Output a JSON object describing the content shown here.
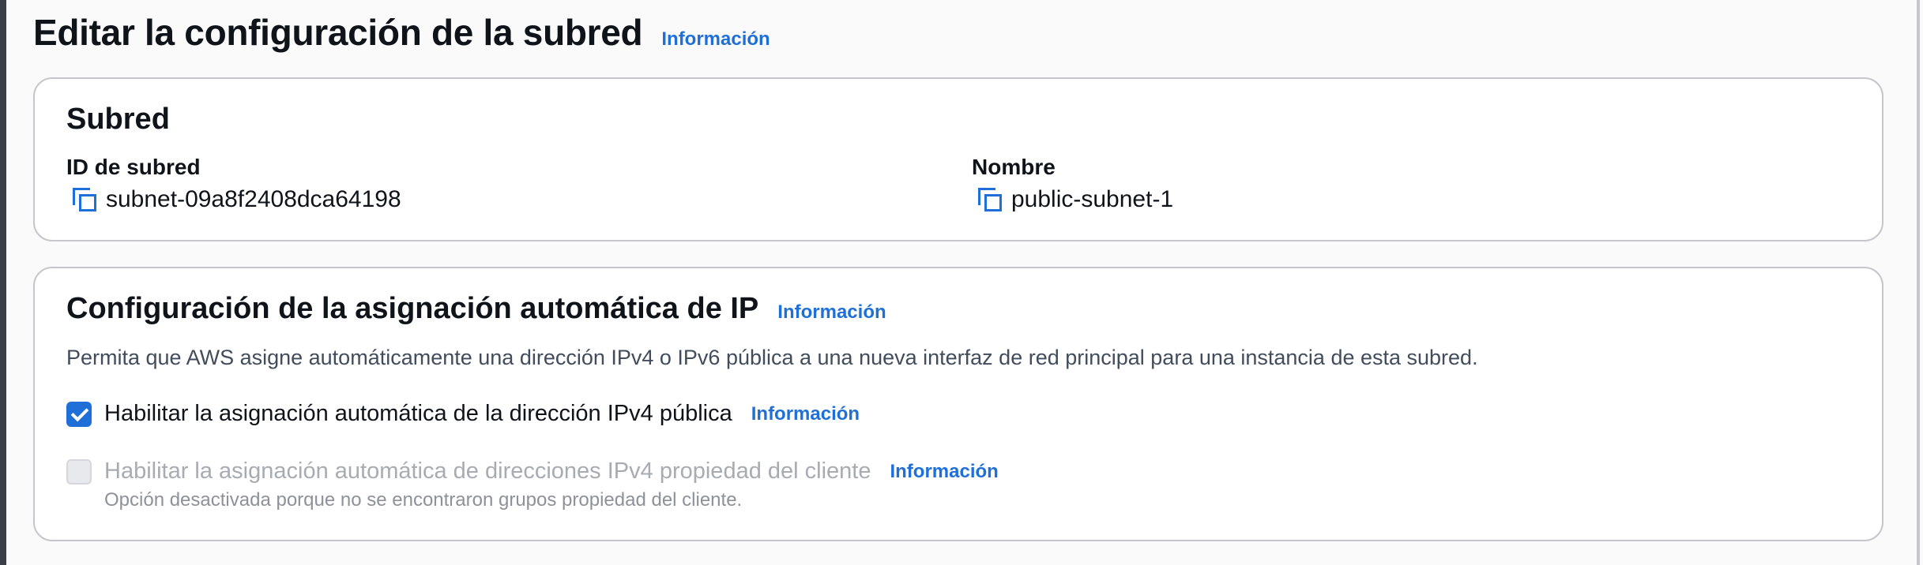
{
  "page": {
    "title": "Editar la configuración de la subred",
    "info_link": "Información"
  },
  "subnet_panel": {
    "title": "Subred",
    "subnet_id": {
      "label": "ID de subred",
      "value": "subnet-09a8f2408dca64198",
      "icon": "copy-icon"
    },
    "name": {
      "label": "Nombre",
      "value": "public-subnet-1",
      "icon": "copy-icon"
    }
  },
  "auto_ip_panel": {
    "title": "Configuración de la asignación automática de IP",
    "info_link": "Información",
    "description": "Permita que AWS asigne automáticamente una dirección IPv4 o IPv6 pública a una nueva interfaz de red principal para una instancia de esta subred.",
    "options": [
      {
        "label": "Habilitar la asignación automática de la dirección IPv4 pública",
        "checked": true,
        "disabled": false,
        "info_link": "Información"
      },
      {
        "label": "Habilitar la asignación automática de direcciones IPv4 propiedad del cliente",
        "checked": false,
        "disabled": true,
        "info_link": "Información",
        "hint": "Opción desactivada porque no se encontraron grupos propiedad del cliente."
      }
    ]
  },
  "colors": {
    "link": "#1f6fd8",
    "checkbox_checked": "#1f6fd8",
    "card_border": "#c6c6cd",
    "disabled_text": "#a7abb2"
  }
}
